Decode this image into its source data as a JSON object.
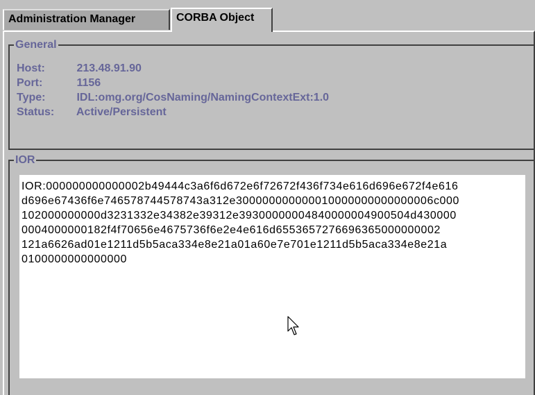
{
  "tabs": [
    {
      "label": "Administration Manager",
      "active": false
    },
    {
      "label": "CORBA Object",
      "active": true
    }
  ],
  "general": {
    "title": "General",
    "rows": [
      {
        "label": "Host:",
        "value": "213.48.91.90"
      },
      {
        "label": "Port:",
        "value": "1156"
      },
      {
        "label": "Type:",
        "value": "IDL:omg.org/CosNaming/NamingContextExt:1.0"
      },
      {
        "label": "Status:",
        "value": "Active/Persistent"
      }
    ]
  },
  "ior": {
    "title": "IOR",
    "lines": [
      "IOR:000000000000002b49444c3a6f6d672e6f72672f436f734e616d696e672f4e616",
      "d696e67436f6e746578744578743a312e300000000000010000000000000006c000",
      "102000000000d3231332e34382e39312e39300000004840000004900504d430000",
      "0004000000182f4f70656e4675736f6e2e4e616d6553657276696365000000002",
      "121a6626ad01e1211d5b5aca334e8e21a01a60e7e701e1211d5b5aca334e8e21a",
      "0100000000000000"
    ]
  },
  "colors": {
    "background": "#c0c0c0",
    "label_text": "#666699",
    "ior_background": "#ffffff"
  },
  "icons": {
    "cursor": "mouse-pointer-icon"
  }
}
